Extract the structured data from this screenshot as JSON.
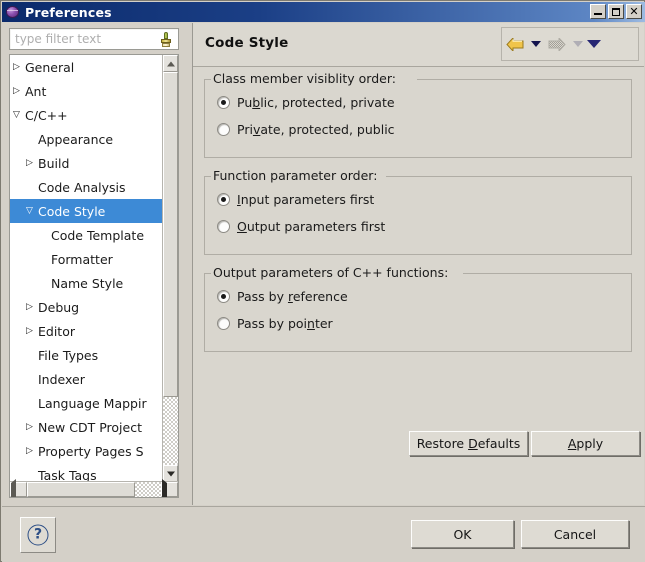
{
  "window": {
    "title": "Preferences",
    "icon": "preferences-sphere-icon",
    "buttons": {
      "minimize": "minimize-icon",
      "maximize": "maximize-icon",
      "close": "close-icon"
    }
  },
  "sidebar": {
    "filter": {
      "placeholder": "type filter text",
      "value": "",
      "clear_icon": "clear-filter-brush-icon"
    },
    "tree": [
      {
        "label": "General",
        "indent": 0,
        "twisty": "collapsed",
        "selected": false
      },
      {
        "label": "Ant",
        "indent": 0,
        "twisty": "collapsed",
        "selected": false
      },
      {
        "label": "C/C++",
        "indent": 0,
        "twisty": "expanded",
        "selected": false
      },
      {
        "label": "Appearance",
        "indent": 1,
        "twisty": "none",
        "selected": false
      },
      {
        "label": "Build",
        "indent": 1,
        "twisty": "collapsed",
        "selected": false
      },
      {
        "label": "Code Analysis",
        "indent": 1,
        "twisty": "none",
        "selected": false
      },
      {
        "label": "Code Style",
        "indent": 1,
        "twisty": "expanded",
        "selected": true
      },
      {
        "label": "Code Template",
        "indent": 2,
        "twisty": "none",
        "selected": false
      },
      {
        "label": "Formatter",
        "indent": 2,
        "twisty": "none",
        "selected": false
      },
      {
        "label": "Name Style",
        "indent": 2,
        "twisty": "none",
        "selected": false
      },
      {
        "label": "Debug",
        "indent": 1,
        "twisty": "collapsed",
        "selected": false
      },
      {
        "label": "Editor",
        "indent": 1,
        "twisty": "collapsed",
        "selected": false
      },
      {
        "label": "File Types",
        "indent": 1,
        "twisty": "none",
        "selected": false
      },
      {
        "label": "Indexer",
        "indent": 1,
        "twisty": "none",
        "selected": false
      },
      {
        "label": "Language Mappir",
        "indent": 1,
        "twisty": "none",
        "selected": false
      },
      {
        "label": "New CDT Project",
        "indent": 1,
        "twisty": "collapsed",
        "selected": false
      },
      {
        "label": "Property Pages S",
        "indent": 1,
        "twisty": "collapsed",
        "selected": false
      },
      {
        "label": "Task Tags",
        "indent": 1,
        "twisty": "none",
        "selected": false
      }
    ],
    "scrollbars": {
      "vertical": "tree-vertical-scrollbar",
      "horizontal": "tree-horizontal-scrollbar"
    }
  },
  "page": {
    "title": "Code Style",
    "nav": {
      "back_icon": "back-arrow-icon",
      "back_dropdown_icon": "back-dropdown-chevron-icon",
      "forward_icon": "forward-arrow-icon",
      "forward_dropdown_icon": "forward-dropdown-chevron-icon",
      "menu_icon": "view-menu-chevron-icon"
    },
    "groups": [
      {
        "legend": "Class member visiblity order:",
        "options": [
          {
            "label_before": "Pu",
            "mnemonic": "b",
            "label_after": "lic, protected, private",
            "checked": true
          },
          {
            "label_before": "Pri",
            "mnemonic": "v",
            "label_after": "ate, protected, public",
            "checked": false
          }
        ]
      },
      {
        "legend": "Function parameter order:",
        "options": [
          {
            "label_before": "",
            "mnemonic": "I",
            "label_after": "nput parameters first",
            "checked": true
          },
          {
            "label_before": "",
            "mnemonic": "O",
            "label_after": "utput parameters first",
            "checked": false
          }
        ]
      },
      {
        "legend": "Output parameters of C++ functions:",
        "options": [
          {
            "label_before": "Pass by ",
            "mnemonic": "r",
            "label_after": "eference",
            "checked": true
          },
          {
            "label_before": "Pass by poi",
            "mnemonic": "n",
            "label_after": "ter",
            "checked": false
          }
        ]
      }
    ],
    "restore_defaults": {
      "before": "Restore ",
      "mnemonic": "D",
      "after": "efaults"
    },
    "apply": {
      "before": "",
      "mnemonic": "A",
      "after": "pply"
    }
  },
  "footer": {
    "help_icon": "help-question-icon",
    "ok_label": "OK",
    "cancel_label": "Cancel"
  },
  "colors": {
    "titlebar_start": "#0b2a6b",
    "titlebar_end": "#9dbbe2",
    "selection_blue": "#3d8ad6",
    "dialog_bg": "#d4d0c8",
    "page_bg": "#d9d6ce",
    "back_arrow": "#e8b93f"
  }
}
